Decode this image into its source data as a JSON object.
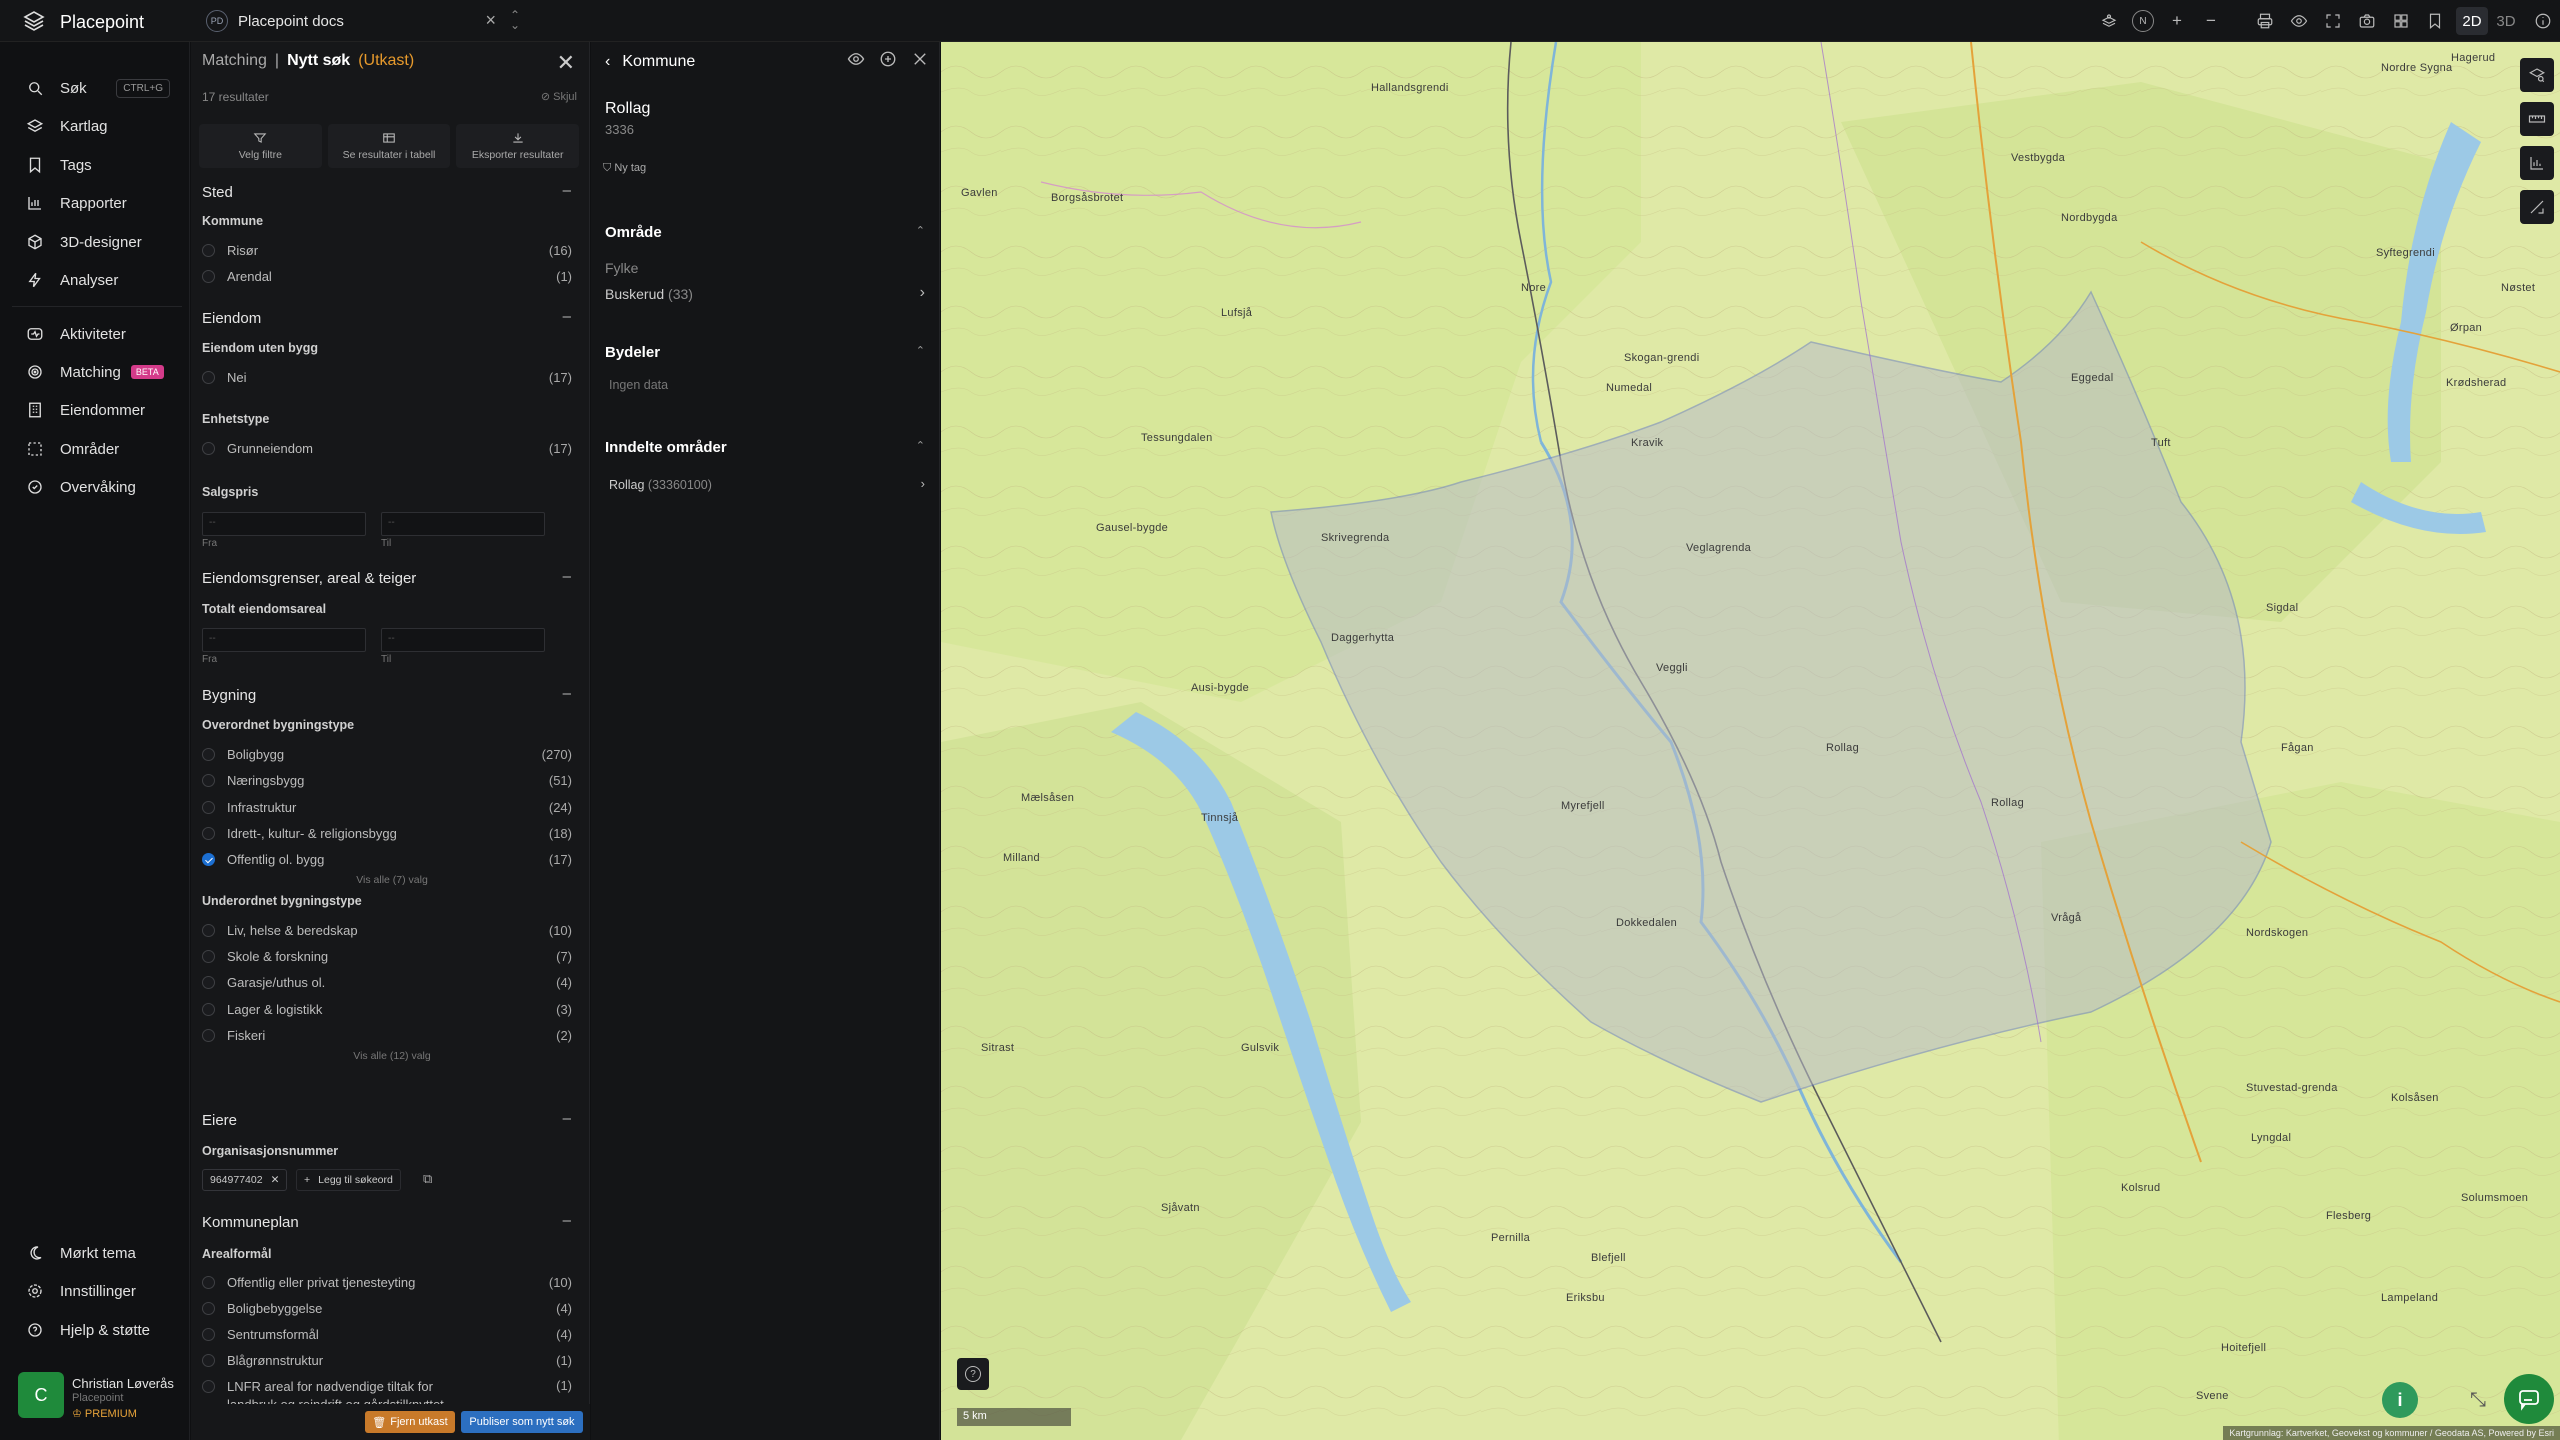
{
  "app": {
    "brand": "Placepoint",
    "workspace": "Placepoint docs",
    "workspace_badge": "PD"
  },
  "map_controls": {
    "compass": "N",
    "mode_2d": "2D",
    "mode_3d": "3D"
  },
  "sidebar": {
    "items": [
      {
        "label": "Søk",
        "icon": "search-icon",
        "shortcut": "CTRL+G"
      },
      {
        "label": "Kartlag",
        "icon": "layers-icon"
      },
      {
        "label": "Tags",
        "icon": "bookmark-icon"
      },
      {
        "label": "Rapporter",
        "icon": "chart-icon"
      },
      {
        "label": "3D-designer",
        "icon": "cube-icon"
      },
      {
        "label": "Analyser",
        "icon": "bolt-icon"
      },
      {
        "label": "Aktiviteter",
        "icon": "activity-icon"
      },
      {
        "label": "Matching",
        "icon": "target-icon",
        "badge": "BETA"
      },
      {
        "label": "Eiendommer",
        "icon": "building-icon"
      },
      {
        "label": "Områder",
        "icon": "area-icon"
      },
      {
        "label": "Overvåking",
        "icon": "monitor-icon"
      }
    ],
    "bottom": [
      {
        "label": "Mørkt tema",
        "icon": "moon-icon"
      },
      {
        "label": "Innstillinger",
        "icon": "gear-icon"
      },
      {
        "label": "Hjelp & støtte",
        "icon": "help-icon"
      }
    ],
    "user": {
      "initial": "C",
      "name": "Christian Løverås",
      "org": "Placepoint",
      "plan": "PREMIUM"
    }
  },
  "filter": {
    "crumb": "Matching",
    "title": "Nytt søk",
    "draft": "(Utkast)",
    "results": "17 resultater",
    "hide": "Skjul",
    "actions": [
      "Velg filtre",
      "Se resultater i tabell",
      "Eksporter resultater"
    ],
    "sted": {
      "title": "Sted",
      "kommune_label": "Kommune",
      "options": [
        {
          "label": "Risør",
          "count": "(16)"
        },
        {
          "label": "Arendal",
          "count": "(1)"
        }
      ]
    },
    "eiendom": {
      "title": "Eiendom",
      "uten_bygg_label": "Eiendom uten bygg",
      "uten_bygg": {
        "label": "Nei",
        "count": "(17)"
      },
      "enhetstype_label": "Enhetstype",
      "enhetstype": {
        "label": "Grunneiendom",
        "count": "(17)"
      },
      "salgspris_label": "Salgspris",
      "from_ph": "--",
      "to_ph": "--",
      "from_label": "Fra",
      "to_label": "Til"
    },
    "grenser": {
      "title": "Eiendomsgrenser, areal & teiger",
      "areal_label": "Totalt eiendomsareal",
      "from_ph": "--",
      "to_ph": "--",
      "from_label": "Fra",
      "to_label": "Til"
    },
    "bygning": {
      "title": "Bygning",
      "overordnet_label": "Overordnet bygningstype",
      "overordnet": [
        {
          "label": "Boligbygg",
          "count": "(270)",
          "checked": false
        },
        {
          "label": "Næringsbygg",
          "count": "(51)",
          "checked": false
        },
        {
          "label": "Infrastruktur",
          "count": "(24)",
          "checked": false
        },
        {
          "label": "Idrett-, kultur- & religionsbygg",
          "count": "(18)",
          "checked": false
        },
        {
          "label": "Offentlig ol. bygg",
          "count": "(17)",
          "checked": true
        }
      ],
      "overordnet_more": "Vis alle (7) valg",
      "underordnet_label": "Underordnet bygningstype",
      "underordnet": [
        {
          "label": "Liv, helse & beredskap",
          "count": "(10)"
        },
        {
          "label": "Skole & forskning",
          "count": "(7)"
        },
        {
          "label": "Garasje/uthus ol.",
          "count": "(4)"
        },
        {
          "label": "Lager & logistikk",
          "count": "(3)"
        },
        {
          "label": "Fiskeri",
          "count": "(2)"
        }
      ],
      "underordnet_more": "Vis alle (12) valg"
    },
    "eiere": {
      "title": "Eiere",
      "org_label": "Organisasjonsnummer",
      "chip": "964977402",
      "add": "Legg til søkeord"
    },
    "kommuneplan": {
      "title": "Kommuneplan",
      "arealformal_label": "Arealformål",
      "options": [
        {
          "label": "Offentlig eller privat tjenesteyting",
          "count": "(10)"
        },
        {
          "label": "Boligbebyggelse",
          "count": "(4)"
        },
        {
          "label": "Sentrumsformål",
          "count": "(4)"
        },
        {
          "label": "Blågrønnstruktur",
          "count": "(1)"
        },
        {
          "label": "LNFR areal for nødvendige tiltak for landbruk og reindrift og gårdstilknyttet næringsvirksomhet basert på gårdens ressursgrunnlag",
          "count": "(1)"
        }
      ]
    },
    "remove_draft": "Fjern utkast",
    "publish": "Publiser som nytt søk"
  },
  "kommune": {
    "header": "Kommune",
    "name": "Rollag",
    "code": "3336",
    "new_tag": "Ny tag",
    "omrade_title": "Område",
    "fylke_label": "Fylke",
    "fylke_value": "Buskerud",
    "fylke_code": "(33)",
    "bydeler_title": "Bydeler",
    "bydeler_empty": "Ingen data",
    "inndelte_title": "Inndelte områder",
    "inndelt_item": "Rollag",
    "inndelt_code": "(33360100)"
  },
  "map": {
    "scale": "5 km",
    "attribution": "Kartgrunnlag: Kartverket, Geovekst og kommuner / Geodata AS, Powered by Esri",
    "labels": [
      [
        "Nordre Sygna"
      ],
      [
        "Hallandsgrendi"
      ],
      [
        "Gavlen"
      ],
      [
        "Borgsåsbrotet"
      ],
      [
        "Nore"
      ],
      [
        "Lufsjå"
      ],
      [
        "Vestbygda"
      ],
      [
        "Hagerud"
      ],
      [
        "Eggedal"
      ],
      [
        "Nordbygda"
      ],
      [
        "Skogan-grendi"
      ],
      [
        "Numedal"
      ],
      [
        "Tessungdalen"
      ],
      [
        "Gausel-bygde"
      ],
      [
        "Skrivegrenda"
      ],
      [
        "Kravik"
      ],
      [
        "Veglagrenda"
      ],
      [
        "Syftegrendi"
      ],
      [
        "Krødsherad"
      ],
      [
        "Ørpan"
      ],
      [
        "Nøstet"
      ],
      [
        "Sigdal"
      ],
      [
        "Tuft"
      ],
      [
        "Veggli"
      ],
      [
        "Rollag"
      ],
      [
        "Ausi-bygde"
      ],
      [
        "Daggerhytta"
      ],
      [
        "Tinnsjå"
      ],
      [
        "Mælsåsen"
      ],
      [
        "Milland"
      ],
      [
        "Rollag"
      ],
      [
        "Myrefjell"
      ],
      [
        "Dokkedalen"
      ],
      [
        "Vrågå"
      ],
      [
        "Nordskogen"
      ],
      [
        "Fågan"
      ],
      [
        "Stuvestad-grenda"
      ],
      [
        "Lyngdal"
      ],
      [
        "Flesberg"
      ],
      [
        "Blefjell"
      ],
      [
        "Lampeland"
      ],
      [
        "Sjåvatn"
      ],
      [
        "Eriksbu"
      ],
      [
        "Sitrast"
      ],
      [
        "Gulsvik"
      ],
      [
        "Pernilla"
      ],
      [
        "Kolsrud"
      ],
      [
        "Svene"
      ],
      [
        "Kolsåsen"
      ],
      [
        "Solumsmoen"
      ],
      [
        "Hoitefjell"
      ]
    ]
  }
}
